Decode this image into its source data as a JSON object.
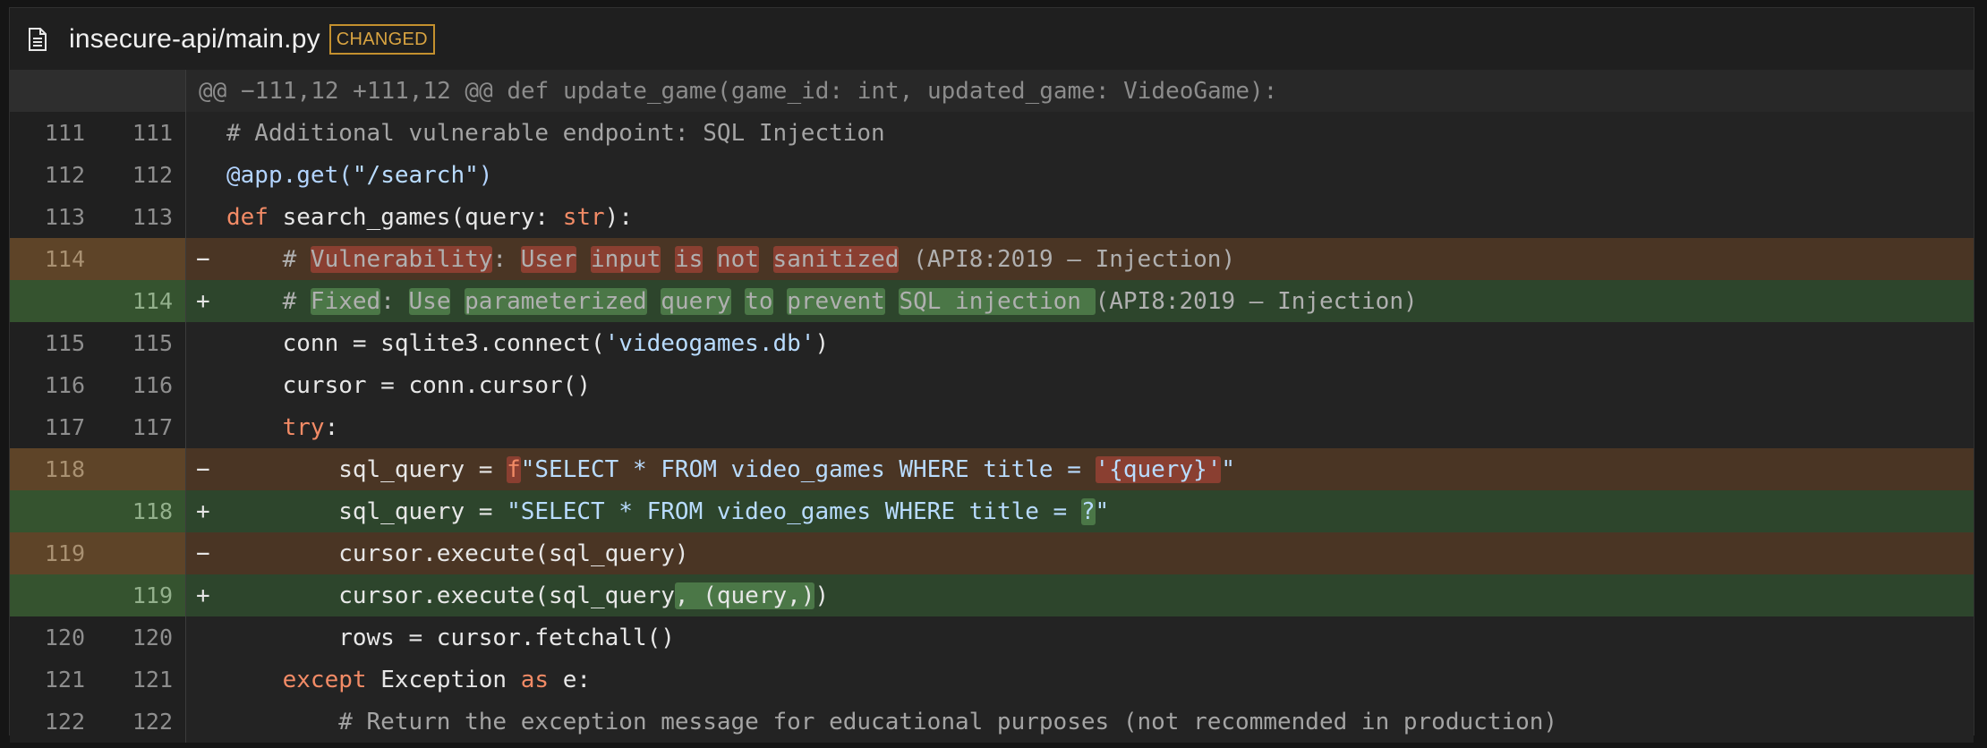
{
  "file": {
    "name": "insecure-api/main.py",
    "badge": "CHANGED",
    "icon": "file-icon"
  },
  "colors": {
    "deleted_row": "#4a3524",
    "added_row": "#2d452c",
    "deleted_highlight": "#8a3f31",
    "added_highlight": "#4b7747",
    "badge": "#d9a441",
    "keyword": "#f28b66"
  },
  "hunk_header": "@@ −111,12 +111,12 @@ def update_game(game_id: int, updated_game: VideoGame):",
  "lines": [
    {
      "old": "111",
      "new": "111",
      "sign": "",
      "type": "ctx",
      "tokens": [
        [
          "cm",
          "# Additional vulnerable endpoint: SQL Injection"
        ]
      ]
    },
    {
      "old": "112",
      "new": "112",
      "sign": "",
      "type": "ctx",
      "tokens": [
        [
          "dec",
          "@app.get("
        ],
        [
          "str",
          "\"/search\""
        ],
        [
          "dec",
          ")"
        ]
      ]
    },
    {
      "old": "113",
      "new": "113",
      "sign": "",
      "type": "ctx",
      "tokens": [
        [
          "kw",
          "def"
        ],
        [
          "t",
          " search_games(query: "
        ],
        [
          "kw",
          "str"
        ],
        [
          "t",
          "):"
        ]
      ]
    },
    {
      "old": "114",
      "new": "",
      "sign": "−",
      "type": "del",
      "tokens": [
        [
          "cm",
          "    # "
        ],
        [
          "cm hl-del",
          "Vulnerability"
        ],
        [
          "cm",
          ": "
        ],
        [
          "cm hl-del",
          "User"
        ],
        [
          "cm",
          " "
        ],
        [
          "cm hl-del",
          "input"
        ],
        [
          "cm",
          " "
        ],
        [
          "cm hl-del",
          "is"
        ],
        [
          "cm",
          " "
        ],
        [
          "cm hl-del",
          "not"
        ],
        [
          "cm",
          " "
        ],
        [
          "cm hl-del",
          "sanitized"
        ],
        [
          "cm",
          " (API8:2019 – Injection)"
        ]
      ]
    },
    {
      "old": "",
      "new": "114",
      "sign": "+",
      "type": "add",
      "tokens": [
        [
          "cm",
          "    # "
        ],
        [
          "cm hl-add",
          "Fixed"
        ],
        [
          "cm",
          ": "
        ],
        [
          "cm hl-add",
          "Use"
        ],
        [
          "cm",
          " "
        ],
        [
          "cm hl-add",
          "parameterized"
        ],
        [
          "cm",
          " "
        ],
        [
          "cm hl-add",
          "query"
        ],
        [
          "cm",
          " "
        ],
        [
          "cm hl-add",
          "to"
        ],
        [
          "cm",
          " "
        ],
        [
          "cm hl-add",
          "prevent"
        ],
        [
          "cm",
          " "
        ],
        [
          "cm hl-add",
          "SQL injection "
        ],
        [
          "cm",
          "(API8:2019 – Injection)"
        ]
      ]
    },
    {
      "old": "115",
      "new": "115",
      "sign": "",
      "type": "ctx",
      "tokens": [
        [
          "t",
          "    conn = sqlite3.connect("
        ],
        [
          "str",
          "'videogames.db'"
        ],
        [
          "t",
          ")"
        ]
      ]
    },
    {
      "old": "116",
      "new": "116",
      "sign": "",
      "type": "ctx",
      "tokens": [
        [
          "t",
          "    cursor = conn.cursor()"
        ]
      ]
    },
    {
      "old": "117",
      "new": "117",
      "sign": "",
      "type": "ctx",
      "tokens": [
        [
          "kw",
          "    try"
        ],
        [
          "t",
          ":"
        ]
      ]
    },
    {
      "old": "118",
      "new": "",
      "sign": "−",
      "type": "del",
      "tokens": [
        [
          "t",
          "        sql_query = "
        ],
        [
          "kw hl-del",
          "f"
        ],
        [
          "str",
          "\"SELECT * FROM video_games WHERE title = "
        ],
        [
          "str hl-del",
          "'{query}'"
        ],
        [
          "str",
          "\""
        ]
      ]
    },
    {
      "old": "",
      "new": "118",
      "sign": "+",
      "type": "add",
      "tokens": [
        [
          "t",
          "        sql_query = "
        ],
        [
          "str",
          "\"SELECT * FROM video_games WHERE title = "
        ],
        [
          "str hl-add",
          "?"
        ],
        [
          "str",
          "\""
        ]
      ]
    },
    {
      "old": "119",
      "new": "",
      "sign": "−",
      "type": "del",
      "tokens": [
        [
          "t",
          "        cursor.execute(sql_query)"
        ]
      ]
    },
    {
      "old": "",
      "new": "119",
      "sign": "+",
      "type": "add",
      "tokens": [
        [
          "t",
          "        cursor.execute(sql_query"
        ],
        [
          "t hl-add",
          ", (query,)"
        ],
        [
          "t",
          ")"
        ]
      ]
    },
    {
      "old": "120",
      "new": "120",
      "sign": "",
      "type": "ctx",
      "tokens": [
        [
          "t",
          "        rows = cursor.fetchall()"
        ]
      ]
    },
    {
      "old": "121",
      "new": "121",
      "sign": "",
      "type": "ctx",
      "tokens": [
        [
          "kw",
          "    except"
        ],
        [
          "t",
          " Exception "
        ],
        [
          "kw",
          "as"
        ],
        [
          "t",
          " e:"
        ]
      ]
    },
    {
      "old": "122",
      "new": "122",
      "sign": "",
      "type": "ctx",
      "tokens": [
        [
          "cm",
          "        # Return the exception message for educational purposes (not recommended in production)"
        ]
      ]
    }
  ]
}
